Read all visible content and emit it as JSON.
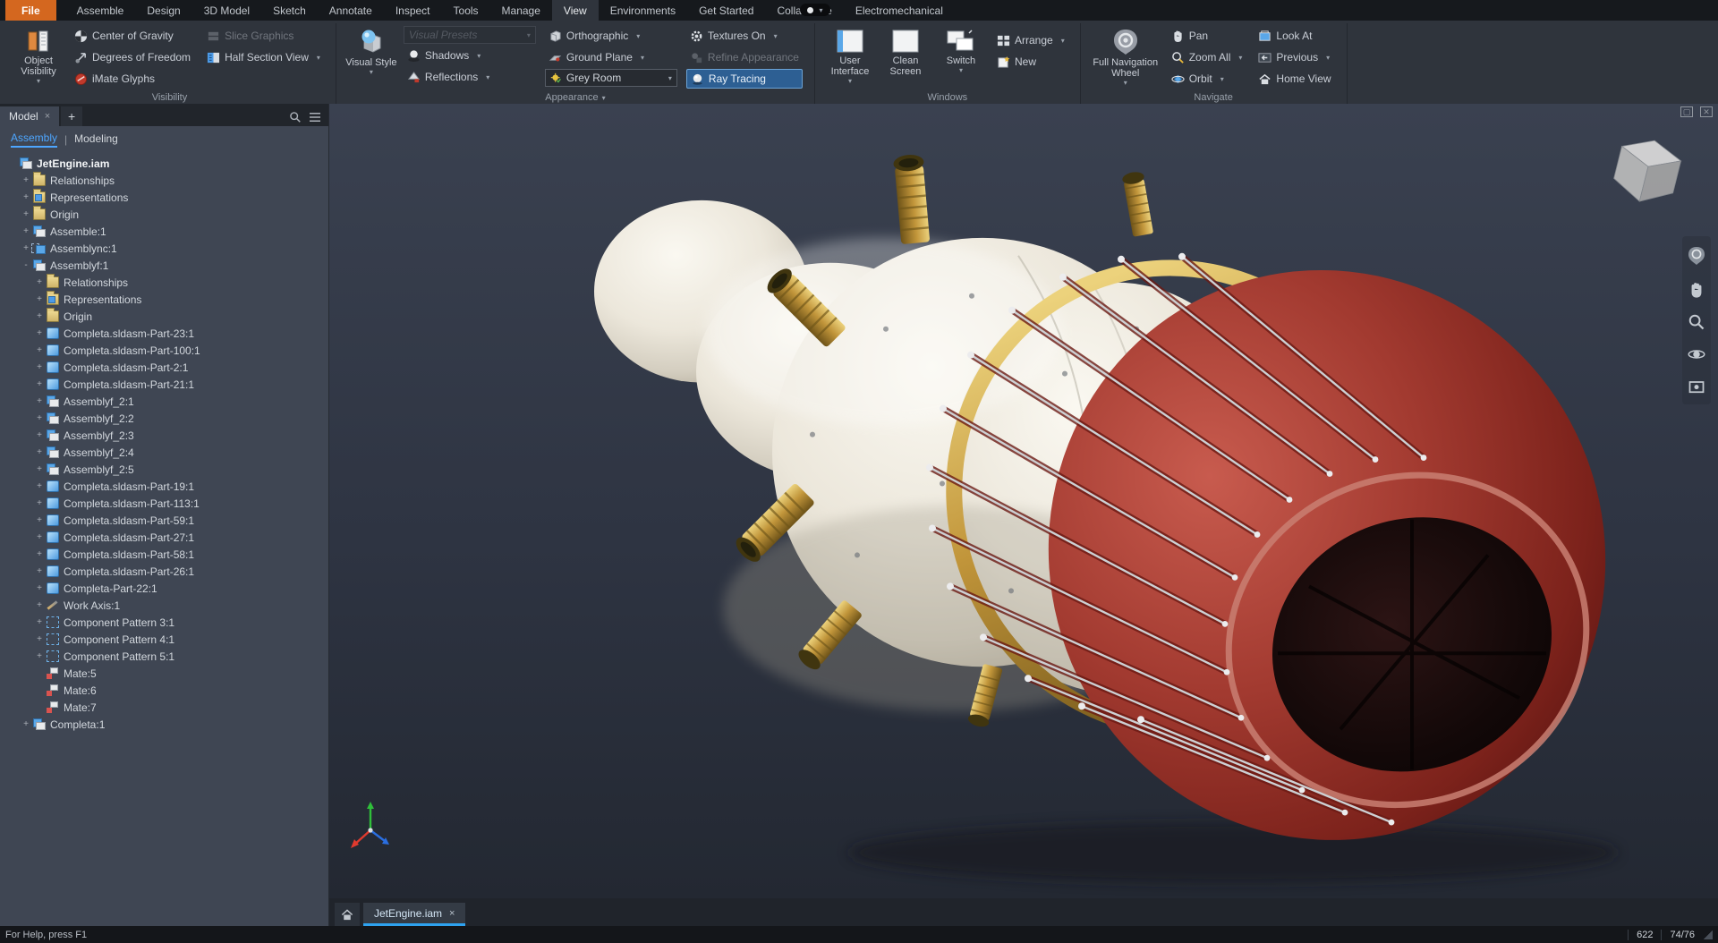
{
  "colors": {
    "file_tab_orange": "#d4671f",
    "accent_blue": "#2ea2f0",
    "assembly_tab_blue": "#4da6ff",
    "ray_tracing_highlight": "#2d5f93",
    "gold": "#c79a3b",
    "engine_red": "#99302a",
    "viewport_bg": "#323a48"
  },
  "menubar": {
    "tabs": [
      {
        "label": "File",
        "state": "file"
      },
      {
        "label": "Assemble"
      },
      {
        "label": "Design"
      },
      {
        "label": "3D Model"
      },
      {
        "label": "Sketch"
      },
      {
        "label": "Annotate"
      },
      {
        "label": "Inspect"
      },
      {
        "label": "Tools"
      },
      {
        "label": "Manage"
      },
      {
        "label": "View",
        "state": "active"
      },
      {
        "label": "Environments"
      },
      {
        "label": "Get Started"
      },
      {
        "label": "Collaborate"
      },
      {
        "label": "Electromechanical"
      }
    ]
  },
  "ribbon": {
    "visibility": {
      "label": "Visibility",
      "object_visibility": "Object Visibility",
      "center_of_gravity": "Center of Gravity",
      "degrees_of_freedom": "Degrees of Freedom",
      "imate_glyphs": "iMate Glyphs",
      "slice_graphics": "Slice Graphics",
      "half_section_view": "Half Section View"
    },
    "appearance": {
      "label": "Appearance",
      "visual_style": "Visual Style",
      "visual_presets": "Visual Presets",
      "shadows": "Shadows",
      "reflections": "Reflections",
      "orthographic": "Orthographic",
      "ground_plane": "Ground Plane",
      "room": "Grey Room",
      "textures": "Textures On",
      "refine_appearance": "Refine Appearance",
      "ray_tracing": "Ray Tracing"
    },
    "windows": {
      "label": "Windows",
      "user_interface": "User Interface",
      "clean_screen": "Clean Screen",
      "switch": "Switch",
      "arrange": "Arrange",
      "new": "New"
    },
    "navigate": {
      "label": "Navigate",
      "wheel": "Full Navigation Wheel",
      "pan": "Pan",
      "zoom_all": "Zoom All",
      "orbit": "Orbit",
      "look_at": "Look At",
      "previous": "Previous",
      "home_view": "Home View"
    }
  },
  "browser": {
    "panel_tab": "Model",
    "panel_tab_close": "×",
    "add_tab_glyph": "+",
    "mode_tab_assembly": "Assembly",
    "mode_tab_separator": "|",
    "mode_tab_modeling": "Modeling",
    "tree": [
      {
        "label": "JetEngine.iam",
        "icon": "asm",
        "indent": 0,
        "expand": "",
        "state": "root"
      },
      {
        "label": "Relationships",
        "icon": "folder",
        "indent": 1,
        "expand": "+"
      },
      {
        "label": "Representations",
        "icon": "folder-rep",
        "indent": 1,
        "expand": "+"
      },
      {
        "label": "Origin",
        "icon": "folder",
        "indent": 1,
        "expand": "+"
      },
      {
        "label": "Assemble:1",
        "icon": "asm",
        "indent": 1,
        "expand": "+"
      },
      {
        "label": "Assemblync:1",
        "icon": "asm-pat",
        "indent": 1,
        "expand": "+"
      },
      {
        "label": "Assemblyf:1",
        "icon": "asm",
        "indent": 1,
        "expand": "-"
      },
      {
        "label": "Relationships",
        "icon": "folder",
        "indent": 2,
        "expand": "+"
      },
      {
        "label": "Representations",
        "icon": "folder-rep",
        "indent": 2,
        "expand": "+"
      },
      {
        "label": "Origin",
        "icon": "folder",
        "indent": 2,
        "expand": "+"
      },
      {
        "label": "Completa.sldasm-Part-23:1",
        "icon": "part",
        "indent": 2,
        "expand": "+"
      },
      {
        "label": "Completa.sldasm-Part-100:1",
        "icon": "part",
        "indent": 2,
        "expand": "+"
      },
      {
        "label": "Completa.sldasm-Part-2:1",
        "icon": "part",
        "indent": 2,
        "expand": "+"
      },
      {
        "label": "Completa.sldasm-Part-21:1",
        "icon": "part",
        "indent": 2,
        "expand": "+"
      },
      {
        "label": "Assemblyf_2:1",
        "icon": "asm",
        "indent": 2,
        "expand": "+"
      },
      {
        "label": "Assemblyf_2:2",
        "icon": "asm",
        "indent": 2,
        "expand": "+"
      },
      {
        "label": "Assemblyf_2:3",
        "icon": "asm",
        "indent": 2,
        "expand": "+"
      },
      {
        "label": "Assemblyf_2:4",
        "icon": "asm",
        "indent": 2,
        "expand": "+"
      },
      {
        "label": "Assemblyf_2:5",
        "icon": "asm",
        "indent": 2,
        "expand": "+"
      },
      {
        "label": "Completa.sldasm-Part-19:1",
        "icon": "part",
        "indent": 2,
        "expand": "+"
      },
      {
        "label": "Completa.sldasm-Part-113:1",
        "icon": "part",
        "indent": 2,
        "expand": "+"
      },
      {
        "label": "Completa.sldasm-Part-59:1",
        "icon": "part",
        "indent": 2,
        "expand": "+"
      },
      {
        "label": "Completa.sldasm-Part-27:1",
        "icon": "part",
        "indent": 2,
        "expand": "+"
      },
      {
        "label": "Completa.sldasm-Part-58:1",
        "icon": "part",
        "indent": 2,
        "expand": "+"
      },
      {
        "label": "Completa.sldasm-Part-26:1",
        "icon": "part",
        "indent": 2,
        "expand": "+"
      },
      {
        "label": "Completa-Part-22:1",
        "icon": "part",
        "indent": 2,
        "expand": "+"
      },
      {
        "label": "Work Axis:1",
        "icon": "axis",
        "indent": 2,
        "expand": "+"
      },
      {
        "label": "Component Pattern 3:1",
        "icon": "pattern",
        "indent": 2,
        "expand": "+"
      },
      {
        "label": "Component Pattern 4:1",
        "icon": "pattern",
        "indent": 2,
        "expand": "+"
      },
      {
        "label": "Component Pattern 5:1",
        "icon": "pattern",
        "indent": 2,
        "expand": "+"
      },
      {
        "label": "Mate:5",
        "icon": "mate",
        "indent": 2,
        "expand": ""
      },
      {
        "label": "Mate:6",
        "icon": "mate",
        "indent": 2,
        "expand": ""
      },
      {
        "label": "Mate:7",
        "icon": "mate",
        "indent": 2,
        "expand": ""
      },
      {
        "label": "Completa:1",
        "icon": "asm",
        "indent": 1,
        "expand": "+"
      }
    ]
  },
  "viewport": {
    "document_tab": "JetEngine.iam",
    "document_tab_close": "×"
  },
  "statusbar": {
    "help_text": "For Help, press F1",
    "occurrences": "622",
    "files": "74/76"
  }
}
